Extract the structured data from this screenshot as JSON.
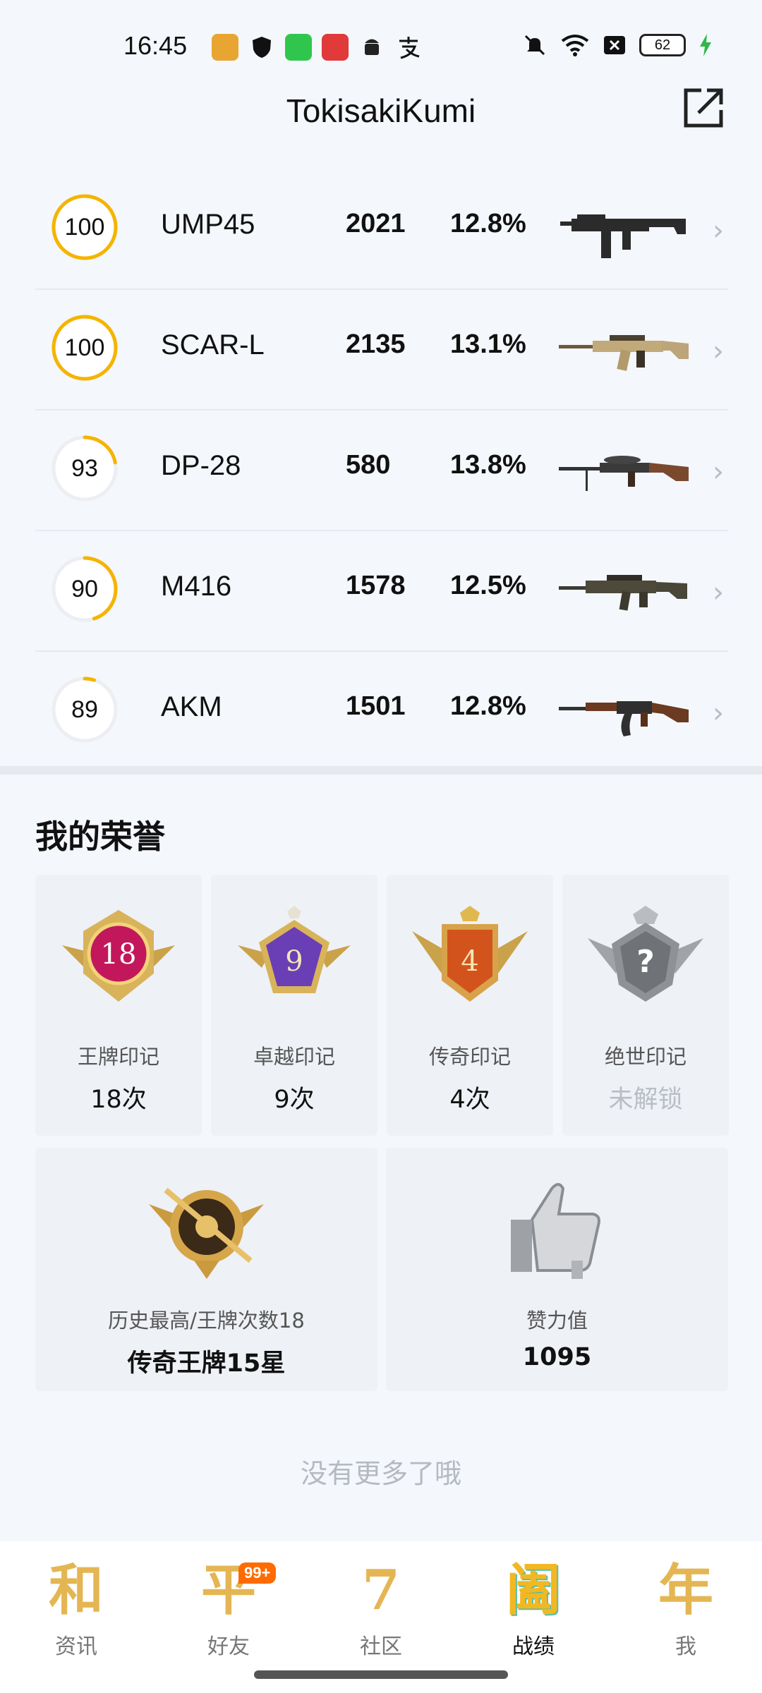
{
  "status_bar": {
    "time": "16:45",
    "battery": "62"
  },
  "header": {
    "title": "TokisakiKumi"
  },
  "weapons": [
    {
      "score": "100",
      "score_fraction": 1.0,
      "name": "UMP45",
      "kills": "2021",
      "rate": "12.8%",
      "gun_type": "smg"
    },
    {
      "score": "100",
      "score_fraction": 1.0,
      "name": "SCAR-L",
      "kills": "2135",
      "rate": "13.1%",
      "gun_type": "rifle-tan"
    },
    {
      "score": "93",
      "score_fraction": 0.22,
      "name": "DP-28",
      "kills": "580",
      "rate": "13.8%",
      "gun_type": "lmg"
    },
    {
      "score": "90",
      "score_fraction": 0.45,
      "name": "M416",
      "kills": "1578",
      "rate": "12.5%",
      "gun_type": "rifle-dark"
    },
    {
      "score": "89",
      "score_fraction": 0.05,
      "name": "AKM",
      "kills": "1501",
      "rate": "12.8%",
      "gun_type": "ak"
    }
  ],
  "honors": {
    "title": "我的荣誉",
    "cards": [
      {
        "label": "王牌印记",
        "value": "18次",
        "badge_text": "18",
        "badge_color": "#c2185b"
      },
      {
        "label": "卓越印记",
        "value": "9次",
        "badge_text": "9",
        "badge_color": "#6a3fb5"
      },
      {
        "label": "传奇印记",
        "value": "4次",
        "badge_text": "4",
        "badge_color": "#d2541c"
      },
      {
        "label": "绝世印记",
        "value": "未解锁",
        "badge_text": "?",
        "badge_color": "#7a7d82"
      }
    ],
    "wide": [
      {
        "label": "历史最高/王牌次数18",
        "value": "传奇王牌15星"
      },
      {
        "label": "赞力值",
        "value": "1095"
      }
    ]
  },
  "footer_note": "没有更多了哦",
  "nav": [
    {
      "glyph": "和",
      "label": "资讯",
      "active": false
    },
    {
      "glyph": "平",
      "label": "好友",
      "active": false,
      "badge": "99+"
    },
    {
      "glyph": "7",
      "label": "社区",
      "active": false
    },
    {
      "glyph": "阖",
      "label": "战绩",
      "active": true
    },
    {
      "glyph": "年",
      "label": "我",
      "active": false
    }
  ],
  "colors": {
    "ring": "#f5b400",
    "ring_track": "#eceef2",
    "accent_orange": "#ff6b00"
  }
}
